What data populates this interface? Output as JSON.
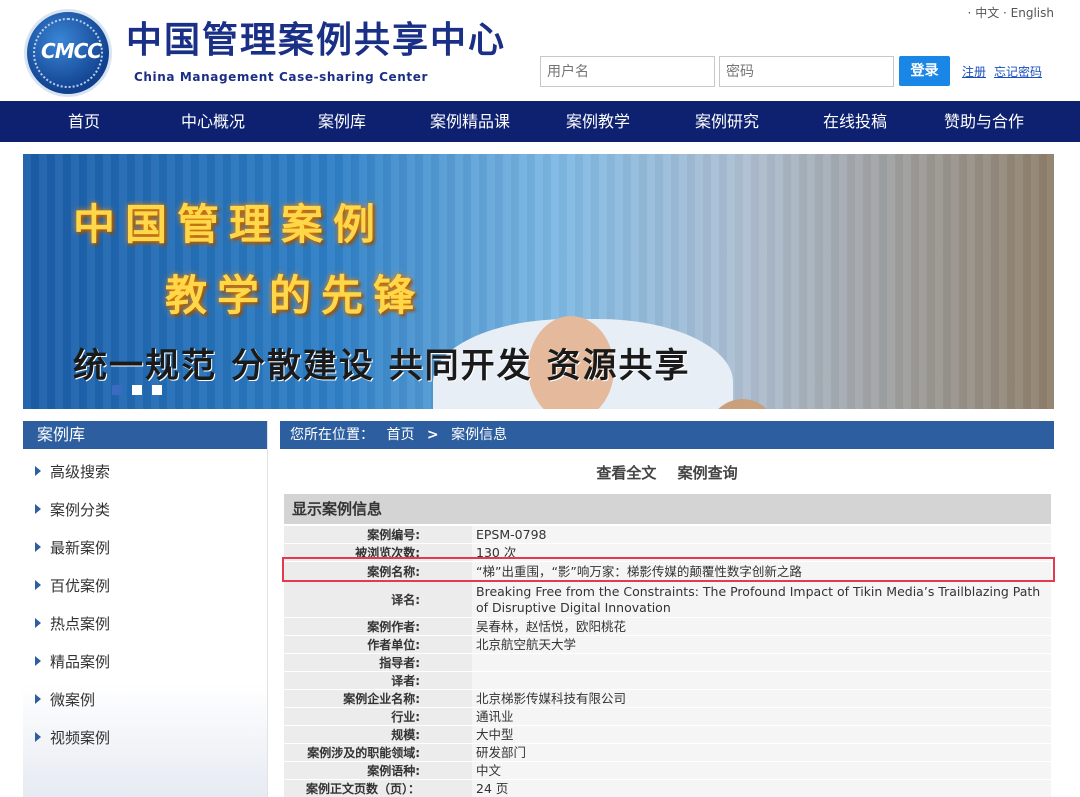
{
  "header": {
    "logo_text": "CMCC",
    "title": "中国管理案例共享中心",
    "subtitle": "China Management Case-sharing Center",
    "lang": [
      "中文",
      "English"
    ],
    "username_placeholder": "用户名",
    "password_placeholder": "密码",
    "login_label": "登录",
    "register_label": "注册",
    "forgot_label": "忘记密码"
  },
  "nav": {
    "items": [
      "首页",
      "中心概况",
      "案例库",
      "案例精品课",
      "案例教学",
      "案例研究",
      "在线投稿",
      "赞助与合作"
    ]
  },
  "banner": {
    "line1": "中国管理案例",
    "line2": "教学的先锋",
    "line3": "统一规范  分散建设  共同开发  资源共享"
  },
  "sidebar": {
    "title": "案例库",
    "items": [
      "高级搜索",
      "案例分类",
      "最新案例",
      "百优案例",
      "热点案例",
      "精品案例",
      "微案例",
      "视频案例"
    ]
  },
  "breadcrumb": {
    "prefix": "您所在位置：",
    "home": "首页",
    "separator": ">",
    "current": "案例信息"
  },
  "actions": {
    "view_full": "查看全文",
    "query": "案例查询"
  },
  "info": {
    "heading": "显示案例信息",
    "rows": [
      {
        "k": "案例编号:",
        "v": "EPSM-0798"
      },
      {
        "k": "被浏览次数:",
        "v": "130 次"
      },
      {
        "k": "案例名称:",
        "v": "“梯”出重围，“影”响万家：梯影传媒的颠覆性数字创新之路"
      },
      {
        "k": "译名:",
        "v": "Breaking Free from the Constraints: The Profound Impact of Tikin Media’s Trailblazing Path of Disruptive Digital Innovation"
      },
      {
        "k": "案例作者:",
        "v": "吴春林，赵恬悦，欧阳桃花"
      },
      {
        "k": "作者单位:",
        "v": "北京航空航天大学"
      },
      {
        "k": "指导者:",
        "v": ""
      },
      {
        "k": "译者:",
        "v": ""
      },
      {
        "k": "案例企业名称:",
        "v": "北京梯影传媒科技有限公司"
      },
      {
        "k": "行业:",
        "v": "通讯业"
      },
      {
        "k": "规模:",
        "v": "大中型"
      },
      {
        "k": "案例涉及的职能领域:",
        "v": "研发部门"
      },
      {
        "k": "案例语种:",
        "v": "中文"
      },
      {
        "k": "案例正文页数（页）：",
        "v": "24 页"
      }
    ]
  }
}
